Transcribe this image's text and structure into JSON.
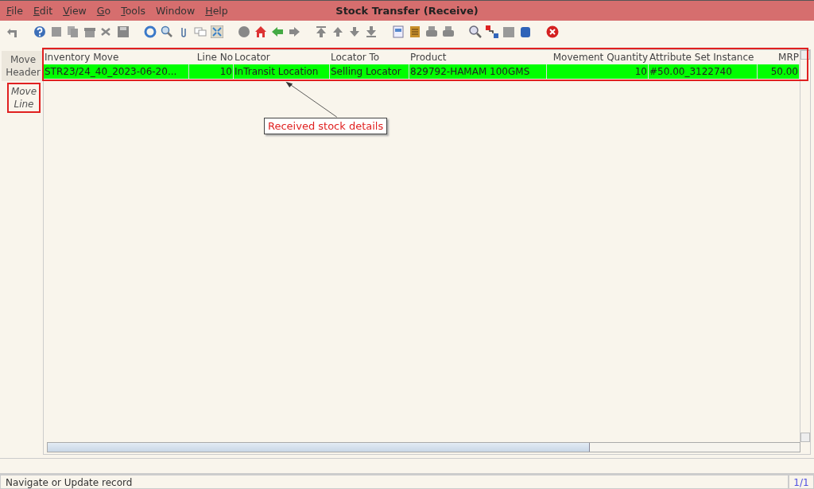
{
  "window": {
    "title": "Stock Transfer (Receive)"
  },
  "menu": [
    {
      "label": "File",
      "mnemonic": true
    },
    {
      "label": "Edit",
      "mnemonic": true
    },
    {
      "label": "View",
      "mnemonic": true
    },
    {
      "label": "Go",
      "mnemonic": true
    },
    {
      "label": "Tools",
      "mnemonic": true
    },
    {
      "label": "Window",
      "mnemonic": false
    },
    {
      "label": "Help",
      "mnemonic": true
    }
  ],
  "tabs": [
    {
      "label": "Move Header",
      "selected": false,
      "highlighted": false
    },
    {
      "label": "Move Line",
      "selected": true,
      "highlighted": true
    }
  ],
  "table": {
    "highlighted": true,
    "columns": [
      {
        "label": "Inventory Move",
        "kind": "text"
      },
      {
        "label": "Line No",
        "kind": "number"
      },
      {
        "label": "Locator",
        "kind": "text"
      },
      {
        "label": "Locator To",
        "kind": "text"
      },
      {
        "label": "Product",
        "kind": "text"
      },
      {
        "label": "Movement Quantity",
        "kind": "number"
      },
      {
        "label": "Attribute Set Instance",
        "kind": "text"
      },
      {
        "label": "MRP",
        "kind": "number"
      }
    ],
    "rows": [
      {
        "selected": true,
        "cells": [
          "STR23/24_40_2023-06-20...",
          "10",
          "InTransit Location",
          "Selling Locator",
          "829792-HAMAM 100GMS",
          "10",
          "#50.00_3122740",
          "50.00"
        ]
      }
    ]
  },
  "callout": {
    "text": "Received stock details"
  },
  "status_bar": {
    "message": "Navigate or Update record",
    "record": "1/1"
  }
}
